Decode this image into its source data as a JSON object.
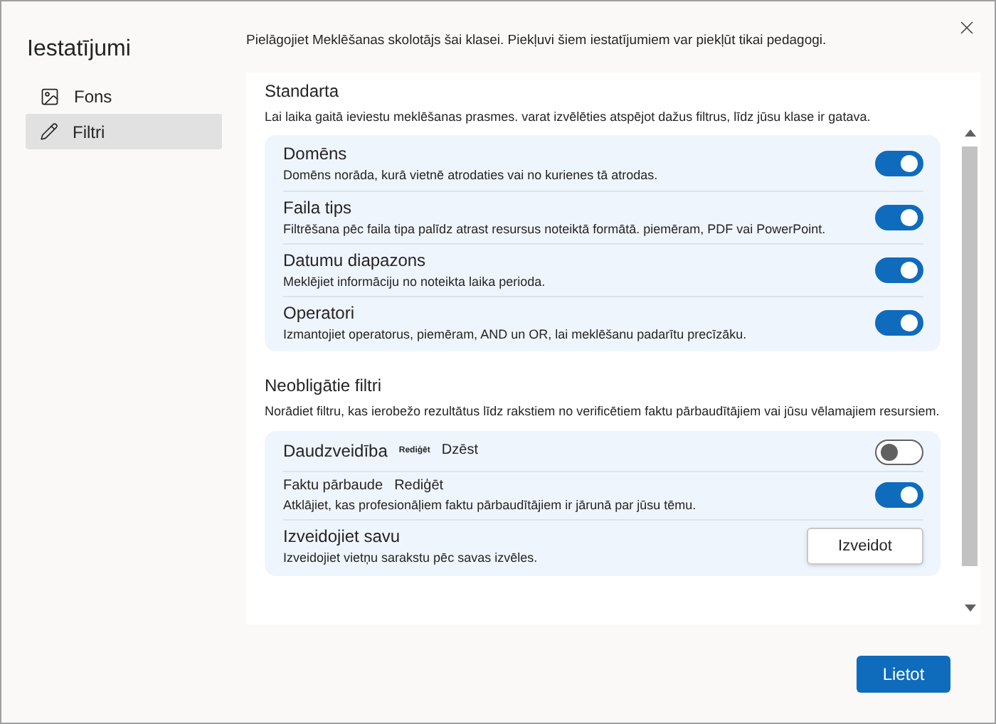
{
  "sidebar": {
    "title": "Iestatījumi",
    "items": [
      {
        "label": "Fons",
        "kind": "image",
        "selected": false
      },
      {
        "label": "Filtri",
        "kind": "pencil",
        "selected": true
      }
    ]
  },
  "intro": "Pielāgojiet Meklēšanas skolotājs šai klasei. Piekļuvi šiem iestatījumiem var piekļūt tikai pedagogi.",
  "sections": [
    {
      "title": "Standarta",
      "description": "Lai laika gaitā ieviestu meklēšanas prasmes. varat izvēlēties atspējot dažus filtrus, līdz jūsu klase ir gatava.",
      "rows": [
        {
          "kind": "toggle",
          "title": "Domēns",
          "description": "Domēns norāda, kurā vietnē atrodaties vai no kurienes tā atrodas.",
          "on": true
        },
        {
          "kind": "toggle",
          "title": "Faila tips",
          "description": "Filtrēšana pēc faila tipa palīdz atrast resursus noteiktā formātā. piemēram, PDF vai PowerPoint.",
          "on": true
        },
        {
          "kind": "toggle",
          "title": "Datumu diapazons",
          "description": "Meklējiet informāciju no noteikta laika perioda.",
          "on": true
        },
        {
          "kind": "toggle",
          "title": "Operatori",
          "description": "Izmantojiet operatorus, piemēram, AND un OR, lai meklēšanu padarītu precīzāku.",
          "on": true
        }
      ]
    },
    {
      "title": "Neobligātie filtri",
      "description": "Norādiet filtru, kas ierobežo rezultātus līdz rakstiem no verificētiem faktu pārbaudītājiem vai jūsu vēlamajiem resursiem.",
      "rows": [
        {
          "kind": "toggle",
          "title": "Daudzveidība",
          "actions": [
            {
              "label": "Rediģēt",
              "kind": "tiny"
            },
            {
              "label": "Dzēst",
              "kind": "normal"
            }
          ],
          "on": false
        },
        {
          "kind": "toggle",
          "title": "Faktu pārbaude",
          "actions": [
            {
              "label": "Rediģēt",
              "kind": "normal"
            }
          ],
          "description": "Atklājiet, kas profesionāļiem faktu pārbaudītājiem ir jārunā par jūsu tēmu.",
          "on": true
        },
        {
          "kind": "button",
          "title": "Izveidojiet savu",
          "description": "Izveidojiet vietņu sarakstu pēc savas izvēles.",
          "button": "Izveidot"
        }
      ]
    }
  ],
  "footer": {
    "button": "Lietot"
  }
}
